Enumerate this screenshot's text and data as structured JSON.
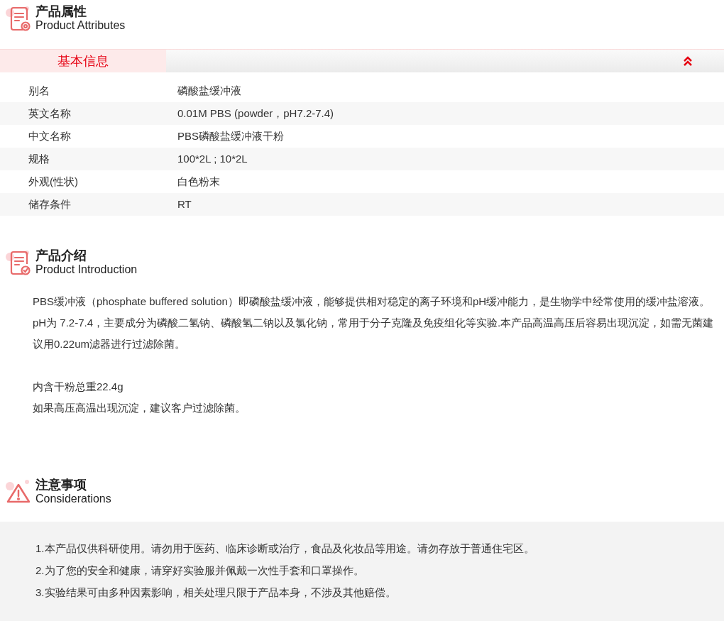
{
  "attributes": {
    "title": "产品属性",
    "subtitle": "Product Attributes",
    "section": {
      "label": "基本信息",
      "expanded": true
    },
    "rows": [
      {
        "label": "别名",
        "value": "磷酸盐缓冲液"
      },
      {
        "label": "英文名称",
        "value": "0.01M PBS (powder，pH7.2-7.4)"
      },
      {
        "label": "中文名称",
        "value": "PBS磷酸盐缓冲液干粉"
      },
      {
        "label": "规格",
        "value": "100*2L ; 10*2L"
      },
      {
        "label": "外观(性状)",
        "value": "白色粉末"
      },
      {
        "label": "储存条件",
        "value": "RT"
      }
    ]
  },
  "introduction": {
    "title": "产品介绍",
    "subtitle": "Product Introduction",
    "paragraphs": [
      "PBS缓冲液（phosphate buffered solution）即磷酸盐缓冲液，能够提供相对稳定的离子环境和pH缓冲能力，是生物学中经常使用的缓冲盐溶液。pH为 7.2-7.4，主要成分为磷酸二氢钠、磷酸氢二钠以及氯化钠，常用于分子克隆及免疫组化等实验.本产品高温高压后容易出现沉淀，如需无菌建议用0.22um滤器进行过滤除菌。"
    ],
    "notes": [
      "内含干粉总重22.4g",
      "如果高压高温出现沉淀，建议客户过滤除菌。"
    ]
  },
  "considerations": {
    "title": "注意事项",
    "subtitle": "Considerations",
    "items": [
      "1.本产品仅供科研使用。请勿用于医药、临床诊断或治疗，食品及化妆品等用途。请勿存放于普通住宅区。",
      "2.为了您的安全和健康，请穿好实验服并佩戴一次性手套和口罩操作。",
      "3.实验结果可由多种因素影响，相关处理只限于产品本身，不涉及其他赔偿。"
    ]
  }
}
